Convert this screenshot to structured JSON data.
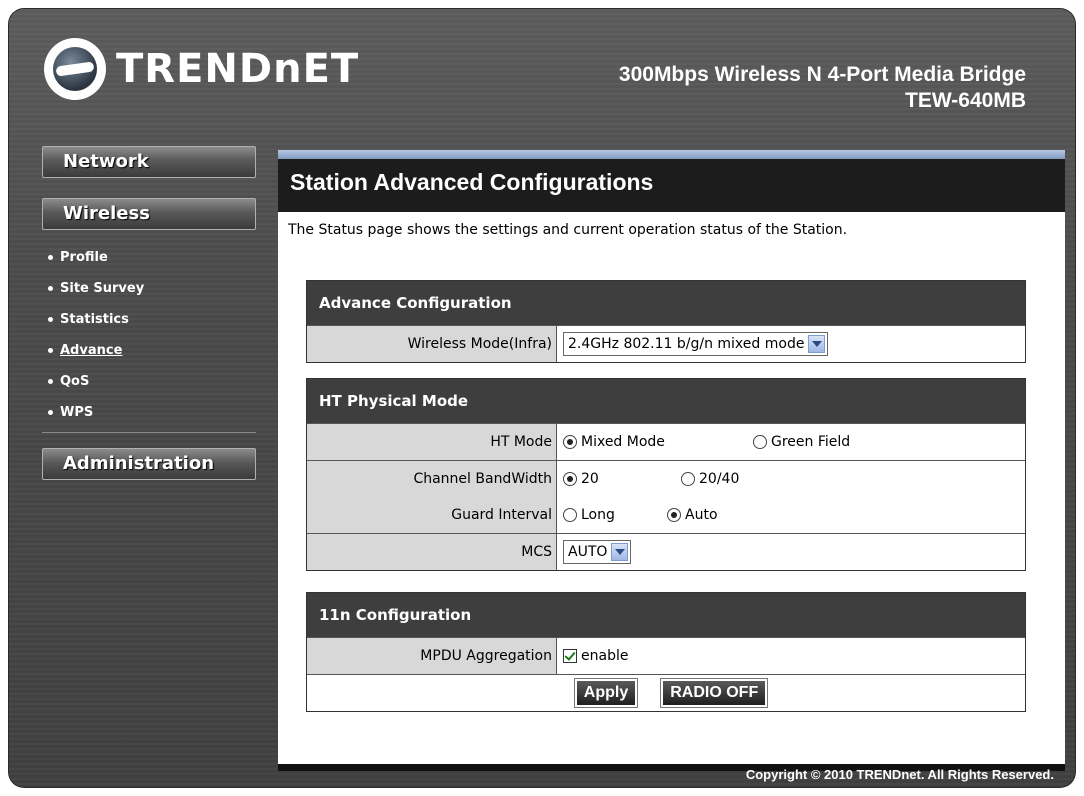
{
  "brand": {
    "logo_text": "TRENDnET",
    "product_title": "300Mbps Wireless N 4-Port Media Bridge",
    "model": "TEW-640MB"
  },
  "sidebar": {
    "network": "Network",
    "wireless": "Wireless",
    "items": [
      {
        "label": "Profile"
      },
      {
        "label": "Site Survey"
      },
      {
        "label": "Statistics"
      },
      {
        "label": "Advance"
      },
      {
        "label": "QoS"
      },
      {
        "label": "WPS"
      }
    ],
    "administration": "Administration"
  },
  "page": {
    "title": "Station Advanced Configurations",
    "description": "The Status page shows the settings and current operation status of the Station."
  },
  "advance": {
    "heading": "Advance Configuration",
    "wireless_mode_label": "Wireless Mode(Infra)",
    "wireless_mode_value": "2.4GHz 802.11 b/g/n mixed mode"
  },
  "ht": {
    "heading": "HT Physical Mode",
    "ht_mode_label": "HT Mode",
    "ht_mode_opt1": "Mixed Mode",
    "ht_mode_opt2": "Green Field",
    "bw_label": "Channel BandWidth",
    "bw_opt1": "20",
    "bw_opt2": "20/40",
    "gi_label": "Guard Interval",
    "gi_opt1": "Long",
    "gi_opt2": "Auto",
    "mcs_label": "MCS",
    "mcs_value": "AUTO"
  },
  "n11": {
    "heading": "11n Configuration",
    "mpdu_label": "MPDU Aggregation",
    "mpdu_check_label": "enable"
  },
  "buttons": {
    "apply": "Apply",
    "radio_off": "RADIO OFF"
  },
  "footer": {
    "copyright": "Copyright © 2010 TRENDnet. All Rights Reserved."
  }
}
